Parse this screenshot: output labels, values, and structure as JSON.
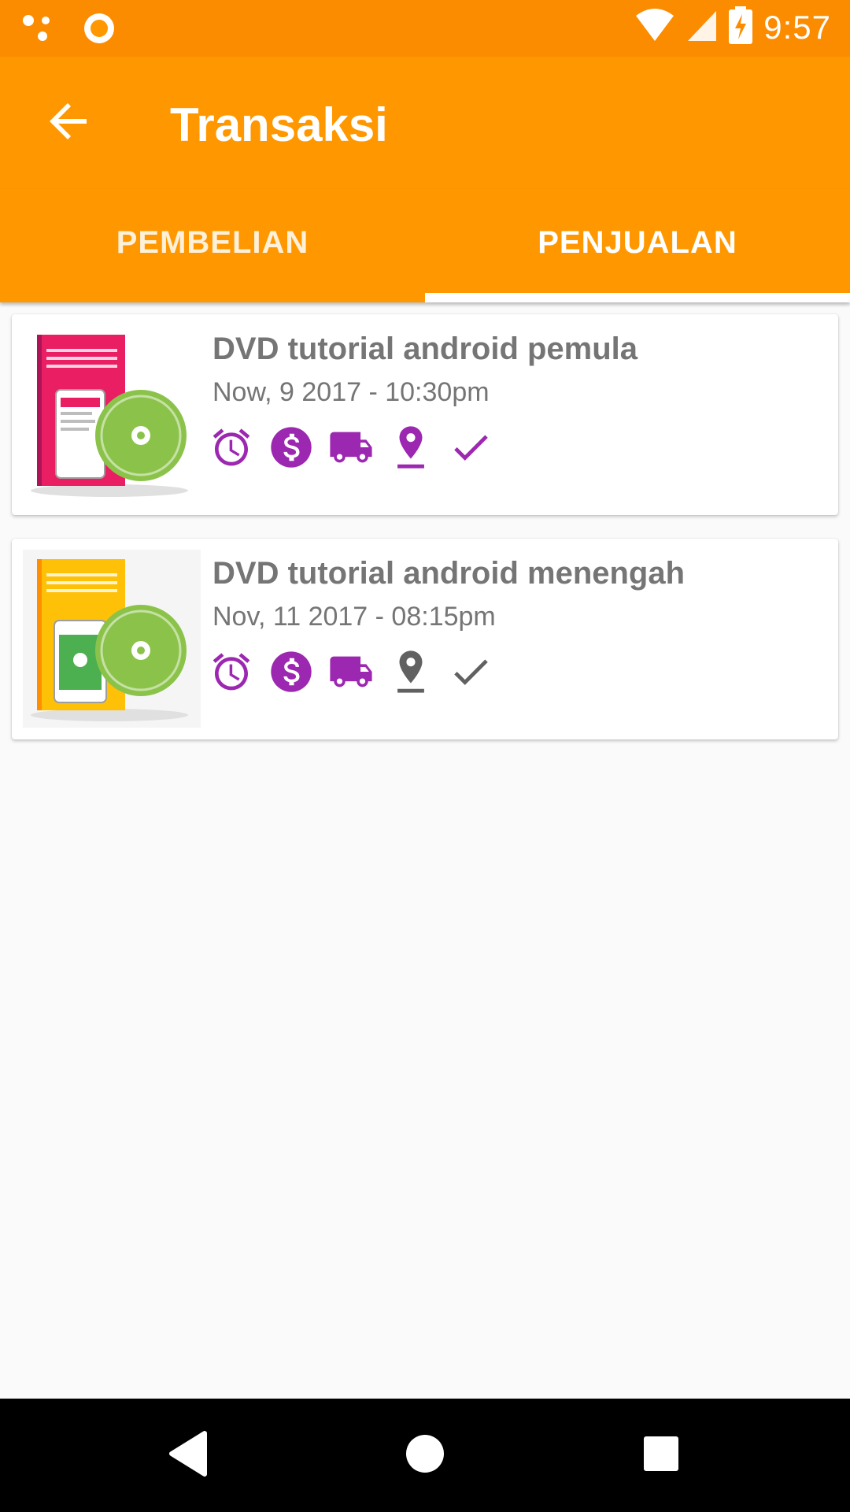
{
  "status_bar": {
    "time": "9:57"
  },
  "app_bar": {
    "title": "Transaksi"
  },
  "tabs": [
    {
      "label": "PEMBELIAN",
      "selected": false
    },
    {
      "label": "PENJUALAN",
      "selected": true
    }
  ],
  "transactions": [
    {
      "title": "DVD tutorial android pemula",
      "date": "Now, 9 2017 - 10:30pm",
      "thumbnail": "pink-dvd-box-with-green-disc",
      "status_icons": [
        "alarm-icon",
        "dollar-icon",
        "truck-icon",
        "location-icon",
        "check-icon"
      ],
      "completed_steps": 5
    },
    {
      "title": "DVD tutorial android menengah",
      "date": "Nov, 11 2017 - 08:15pm",
      "thumbnail": "yellow-dvd-box-with-green-disc",
      "status_icons": [
        "alarm-icon",
        "dollar-icon",
        "truck-icon",
        "location-icon",
        "check-icon"
      ],
      "completed_steps": 3
    }
  ],
  "colors": {
    "status_bar": "#fb8c00",
    "app_bar": "#ff9800",
    "active_icon": "#9c27b0",
    "inactive_icon": "#616161",
    "text_secondary": "#757575"
  }
}
